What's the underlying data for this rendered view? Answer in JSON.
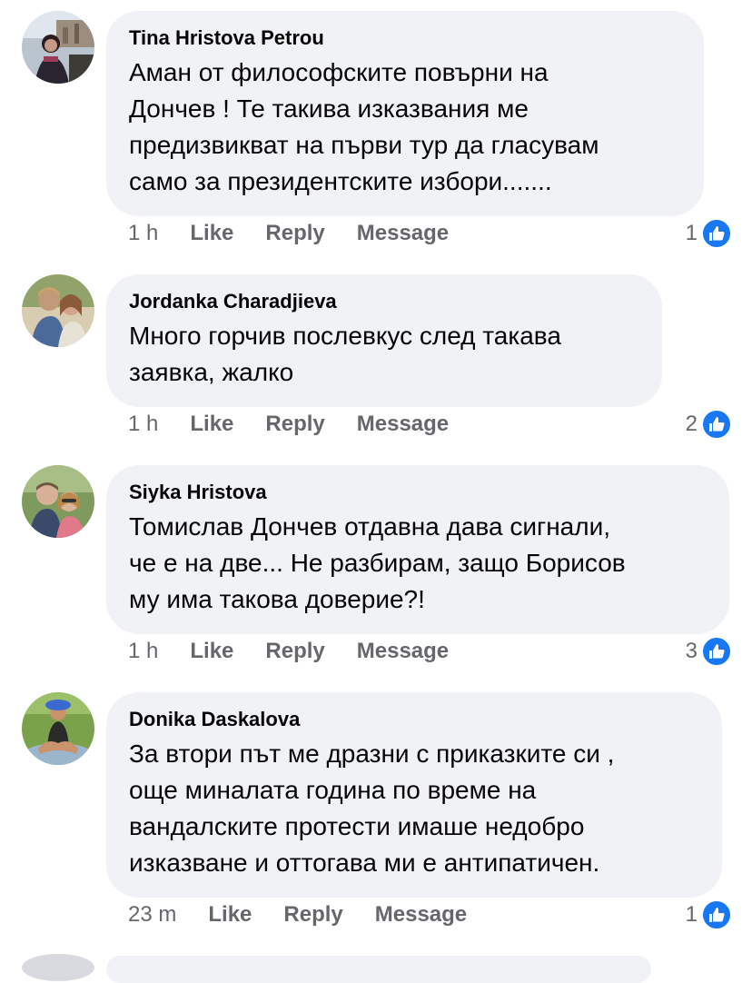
{
  "comments": [
    {
      "author": "Tina Hristova Petrou",
      "text": "Аман от философските повърни на\nДончев ! Те такива изказвания ме\nпредизвикват на първи тур да гласувам\nсамо за президентските избори.......",
      "time": "1 h",
      "like": "Like",
      "reply": "Reply",
      "message": "Message",
      "reactions": "1",
      "icon": "like-icon"
    },
    {
      "author": "Jordanka Charadjieva",
      "text": "Много горчив послевкус след такава\nзаявка, жалко",
      "time": "1 h",
      "like": "Like",
      "reply": "Reply",
      "message": "Message",
      "reactions": "2",
      "icon": "like-icon"
    },
    {
      "author": "Siyka Hristova",
      "text": "Томислав Дончев отдавна дава сигнали,\nче е на две... Не разбирам, защо Борисов\nму има такова доверие?!",
      "time": "1 h",
      "like": "Like",
      "reply": "Reply",
      "message": "Message",
      "reactions": "3",
      "icon": "like-icon"
    },
    {
      "author": "Donika Daskalova",
      "text": "За втори път ме дразни с приказките си ,\nоще миналата година по време на\nвандалските протести имаше недобро\nизказване и оттогава ми е антипатичен.",
      "time": "23 m",
      "like": "Like",
      "reply": "Reply",
      "message": "Message",
      "reactions": "1",
      "icon": "like-icon"
    }
  ],
  "colors": {
    "bubble": "#f0f2f5",
    "secondary_text": "#65676b",
    "like_blue": "#1877f2"
  }
}
